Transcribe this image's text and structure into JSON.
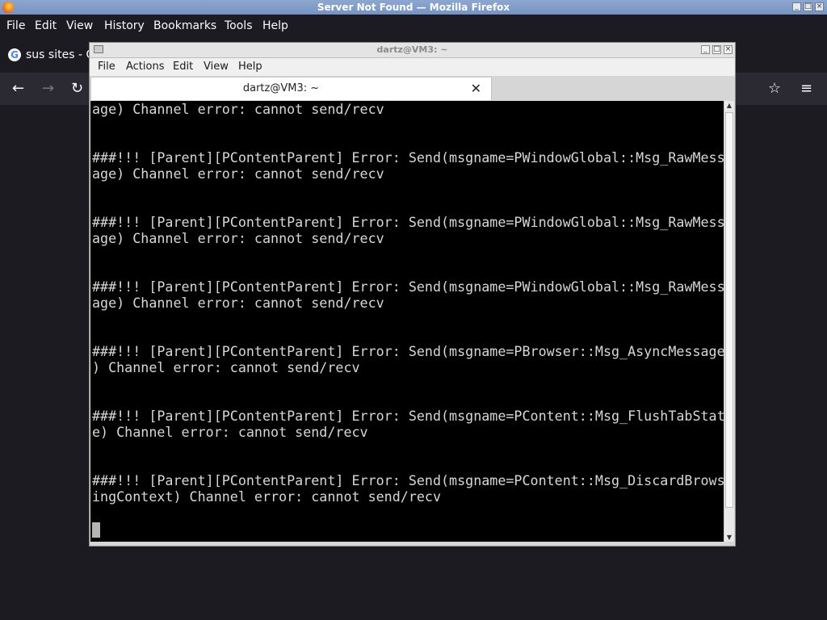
{
  "firefox": {
    "window_title": "Server Not Found — Mozilla Firefox",
    "menu": [
      "File",
      "Edit",
      "View",
      "History",
      "Bookmarks",
      "Tools",
      "Help"
    ],
    "tab": {
      "title": "sus sites - G",
      "favicon": "G"
    },
    "nav_icons": {
      "back": "←",
      "forward": "→",
      "reload": "↻",
      "bookmark": "☆",
      "menu": "≡"
    }
  },
  "terminal": {
    "window_title": "dartz@VM3: ~",
    "menu": [
      "File",
      "Actions",
      "Edit",
      "View",
      "Help"
    ],
    "tab_title": "dartz@VM3: ~",
    "tab_close": "✕",
    "lines": [
      "age) Channel error: cannot send/recv",
      "",
      "",
      "###!!! [Parent][PContentParent] Error: Send(msgname=PWindowGlobal::Msg_RawMess",
      "age) Channel error: cannot send/recv",
      "",
      "",
      "###!!! [Parent][PContentParent] Error: Send(msgname=PWindowGlobal::Msg_RawMess",
      "age) Channel error: cannot send/recv",
      "",
      "",
      "###!!! [Parent][PContentParent] Error: Send(msgname=PWindowGlobal::Msg_RawMess",
      "age) Channel error: cannot send/recv",
      "",
      "",
      "###!!! [Parent][PContentParent] Error: Send(msgname=PBrowser::Msg_AsyncMessage",
      ") Channel error: cannot send/recv",
      "",
      "",
      "###!!! [Parent][PContentParent] Error: Send(msgname=PContent::Msg_FlushTabStat",
      "e) Channel error: cannot send/recv",
      "",
      "",
      "###!!! [Parent][PContentParent] Error: Send(msgname=PContent::Msg_DiscardBrows",
      "ingContext) Channel error: cannot send/recv"
    ]
  },
  "colors": {
    "firefox_bg": "#1c1b22",
    "terminal_bg": "#000000",
    "terminal_fg": "#d7d7d7"
  }
}
